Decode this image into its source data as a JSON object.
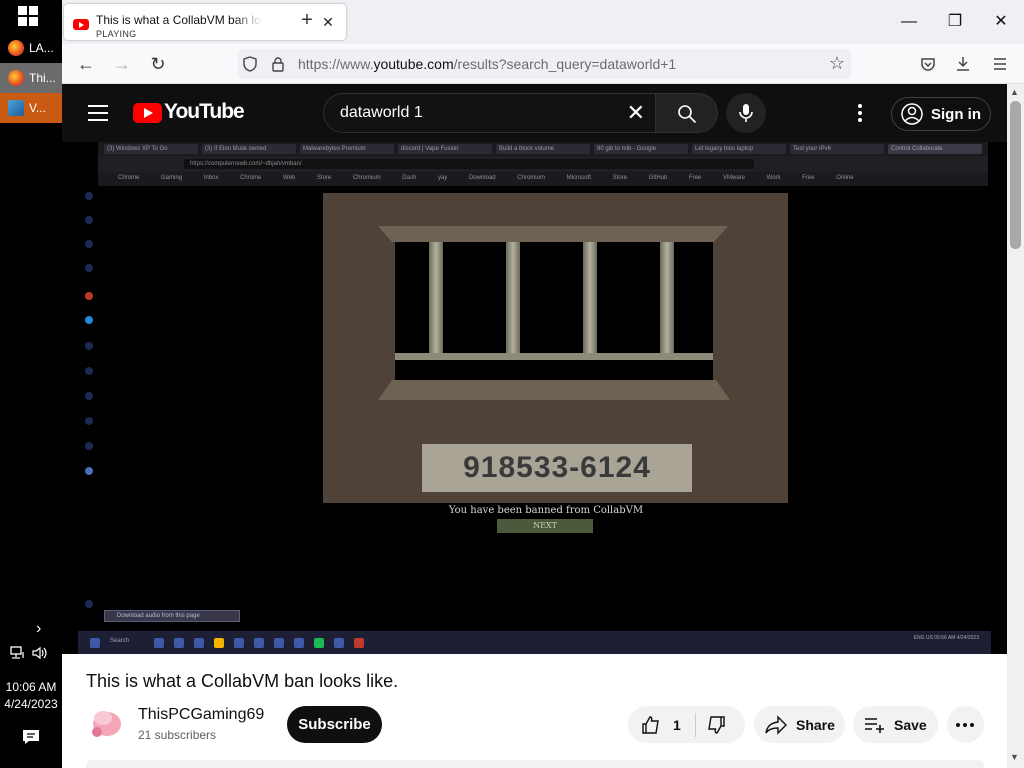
{
  "windows_taskbar": {
    "items": [
      {
        "label": "LA...",
        "icon": "firefox-icon"
      },
      {
        "label": "Thi...",
        "icon": "firefox-icon"
      },
      {
        "label": "V...",
        "icon": "vm-app-icon"
      }
    ],
    "clock_time": "10:06 AM",
    "clock_date": "4/24/2023"
  },
  "browser": {
    "tab": {
      "title": "This is what a CollabVM ban looks like.",
      "status": "PLAYING"
    },
    "url_host_prefix": "https://www.",
    "url_host": "youtube.com",
    "url_path": "/results?search_query=dataworld+1"
  },
  "youtube": {
    "logo_text": "YouTube",
    "search_query": "dataworld 1",
    "sign_in_label": "Sign in"
  },
  "video_frame": {
    "ban_number": "918533-6124",
    "ban_message": "You have been banned from CollabVM",
    "next_label": "NEXT",
    "recorded_tabs": [
      "(3) Windows XP To Go",
      "(3) If Elon Musk owned",
      "Malwarebytes Premium",
      "discord | Vape Fusion",
      "Build a block volume",
      "90 gib to mib - Google",
      "Let legacy bios laptop",
      "Test your IPv6",
      "Control Collaborate"
    ],
    "recorded_url": "https://computernewb.com/~dbjah/vmban/",
    "recorded_bookmarks": "Chrome Gaming Inbox Chrome Web Store Chromium Dash yay Download Chromium Microsoft Store GitHub Free VMware Work Free Online",
    "download_bar": "Download audio from this page",
    "taskbar_search": "Search",
    "recorded_clock": "ENG US 09:56 AM 4/24/2023"
  },
  "video": {
    "title": "This is what a CollabVM ban looks like.",
    "channel_name": "ThisPCGaming69",
    "subscribers": "21 subscribers",
    "subscribe_label": "Subscribe",
    "like_count": "1",
    "share_label": "Share",
    "save_label": "Save"
  }
}
